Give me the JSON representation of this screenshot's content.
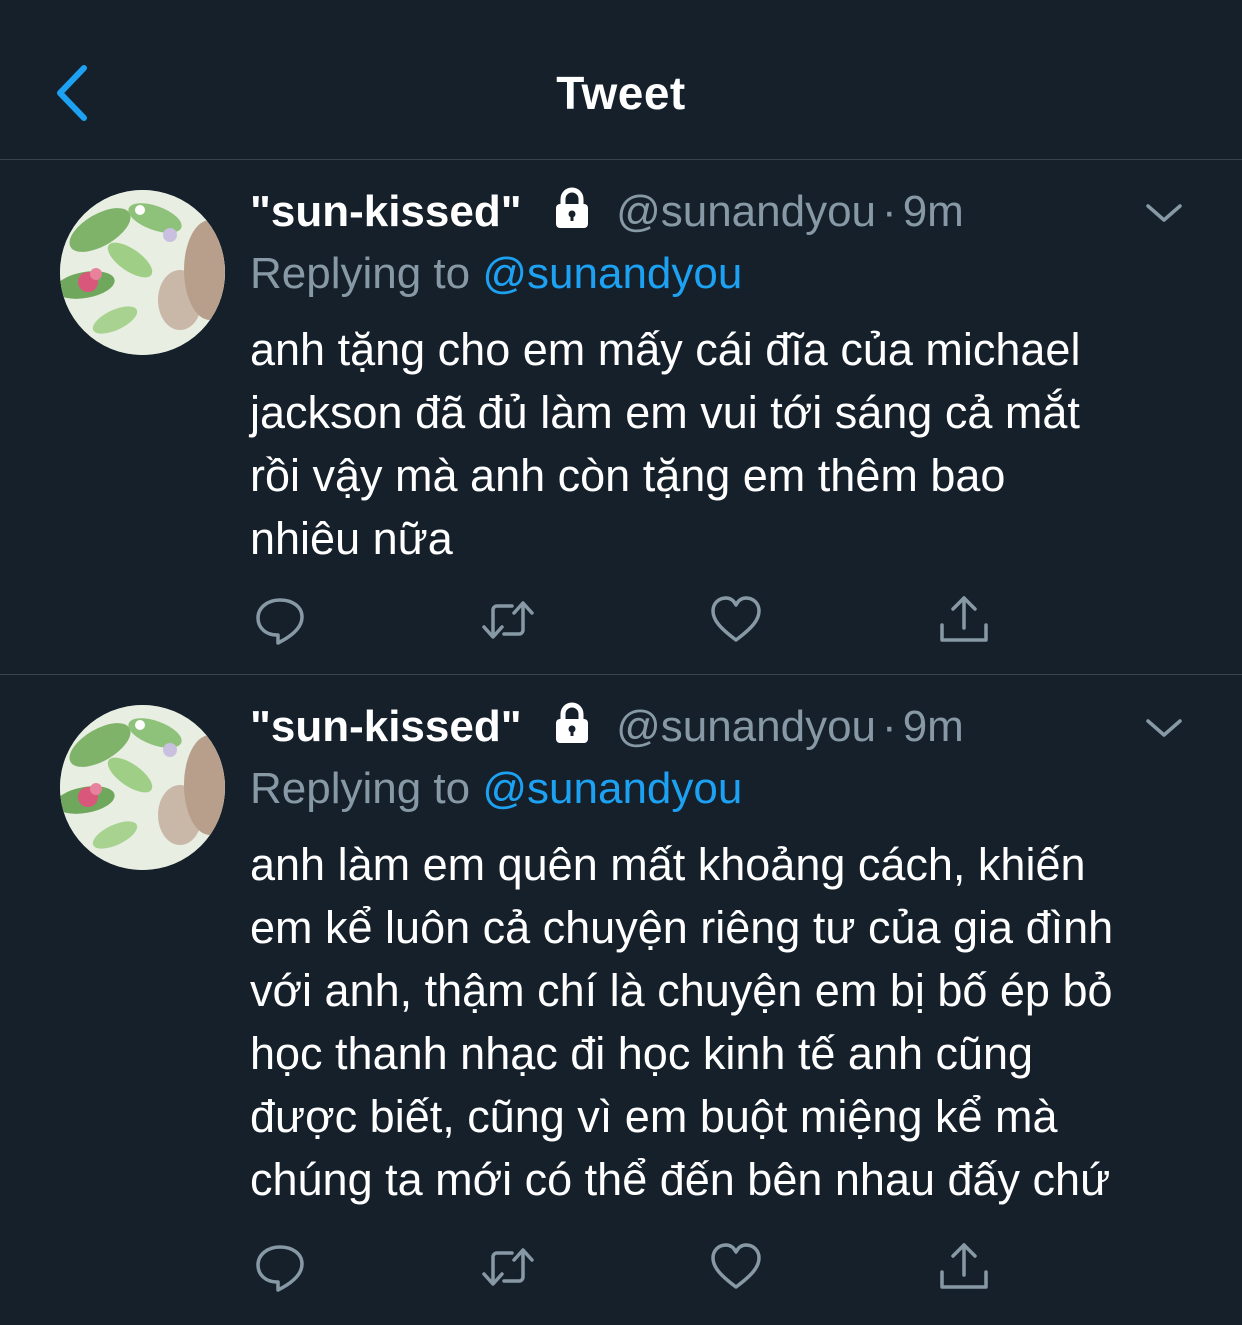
{
  "header": {
    "title": "Tweet",
    "back_icon": "chevron-left-icon",
    "accent_color": "#1da1f2"
  },
  "colors": {
    "background": "#15202b",
    "divider": "#38444d",
    "secondary_text": "#8899a6",
    "link": "#1da1f2"
  },
  "tweets": [
    {
      "display_name": "\"sun-kissed\"",
      "protected_icon": "lock-icon",
      "handle": "@sunandyou",
      "separator": "·",
      "time": "9m",
      "reply_prefix": "Replying to",
      "reply_handle": "@sunandyou",
      "text": "anh tặng cho em mấy cái đĩa của michael jackson đã đủ làm em vui tới sáng cả mắt rồi vậy mà anh còn tặng em thêm bao nhiêu nữa",
      "text_lines": [
        "anh tặng cho em mấy cái đĩa của michael",
        "jackson đã đủ làm em vui tới sáng cả mắt",
        "rồi vậy mà anh còn tặng em thêm bao",
        "nhiêu nữa"
      ],
      "actions": [
        "reply-icon",
        "retweet-icon",
        "like-icon",
        "share-icon"
      ]
    },
    {
      "display_name": "\"sun-kissed\"",
      "protected_icon": "lock-icon",
      "handle": "@sunandyou",
      "separator": "·",
      "time": "9m",
      "reply_prefix": "Replying to",
      "reply_handle": "@sunandyou",
      "text": "anh làm em quên mất khoảng cách, khiến em kể luôn cả chuyện riêng tư của gia đình với anh, thậm chí là chuyện em bị bố ép bỏ học thanh nhạc đi học kinh tế anh cũng được biết, cũng vì em buột miệng kể mà chúng ta mới có thể đến bên nhau đấy chứ",
      "text_lines": [
        "anh làm em quên mất khoảng cách, khiến",
        "em kể luôn cả chuyện riêng tư của gia đình",
        "với anh, thậm chí là chuyện em bị bố ép bỏ",
        "học thanh nhạc đi học kinh tế anh cũng",
        "được biết, cũng vì em buột miệng kể mà",
        "chúng ta mới có thể đến bên nhau đấy chứ"
      ],
      "actions": [
        "reply-icon",
        "retweet-icon",
        "like-icon",
        "share-icon"
      ]
    }
  ]
}
